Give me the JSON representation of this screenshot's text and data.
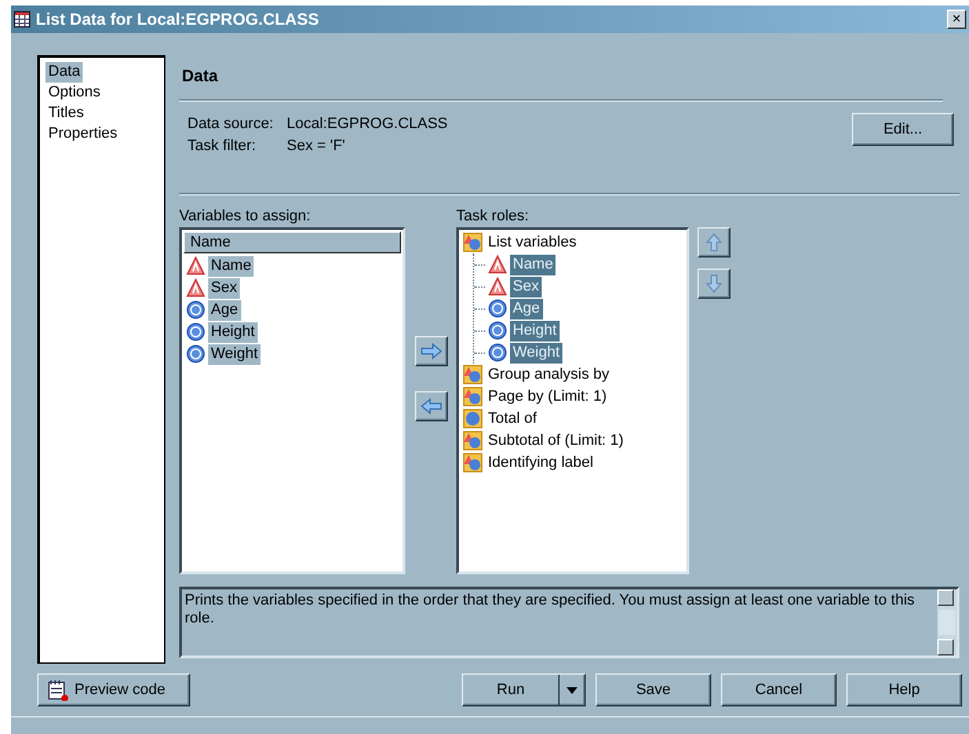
{
  "window": {
    "title": "List Data for Local:EGPROG.CLASS",
    "close": "×"
  },
  "sidebar": {
    "items": [
      {
        "label": "Data",
        "selected": true
      },
      {
        "label": "Options",
        "selected": false
      },
      {
        "label": "Titles",
        "selected": false
      },
      {
        "label": "Properties",
        "selected": false
      }
    ]
  },
  "section_title": "Data",
  "info": [
    {
      "label": "Data source:",
      "value": "Local:EGPROG.CLASS"
    },
    {
      "label": "Task filter:",
      "value": "Sex = 'F'"
    }
  ],
  "edit_button": "Edit...",
  "variables": {
    "label": "Variables to assign:",
    "column": "Name",
    "items": [
      {
        "name": "Name",
        "kind": "char",
        "selected": true
      },
      {
        "name": "Sex",
        "kind": "char",
        "selected": true
      },
      {
        "name": "Age",
        "kind": "num",
        "selected": true
      },
      {
        "name": "Height",
        "kind": "num",
        "selected": true
      },
      {
        "name": "Weight",
        "kind": "num",
        "selected": true
      }
    ]
  },
  "task_roles": {
    "label": "Task roles:",
    "roles": [
      {
        "name": "List variables",
        "kind": "mixed",
        "children": [
          {
            "name": "Name",
            "kind": "char",
            "selected": true
          },
          {
            "name": "Sex",
            "kind": "char",
            "selected": true
          },
          {
            "name": "Age",
            "kind": "num",
            "selected": true
          },
          {
            "name": "Height",
            "kind": "num",
            "selected": true
          },
          {
            "name": "Weight",
            "kind": "num",
            "selected": true
          }
        ]
      },
      {
        "name": "Group analysis by",
        "kind": "mixed"
      },
      {
        "name": "Page by  (Limit: 1)",
        "kind": "mixed"
      },
      {
        "name": "Total of",
        "kind": "numeric"
      },
      {
        "name": "Subtotal of  (Limit: 1)",
        "kind": "mixed"
      },
      {
        "name": "Identifying label",
        "kind": "mixed"
      }
    ]
  },
  "description": "Prints the variables specified in the order that they are specified. You must assign at least one variable to this role.",
  "buttons": {
    "preview": "Preview code",
    "run": "Run",
    "save": "Save",
    "cancel": "Cancel",
    "help": "Help"
  }
}
